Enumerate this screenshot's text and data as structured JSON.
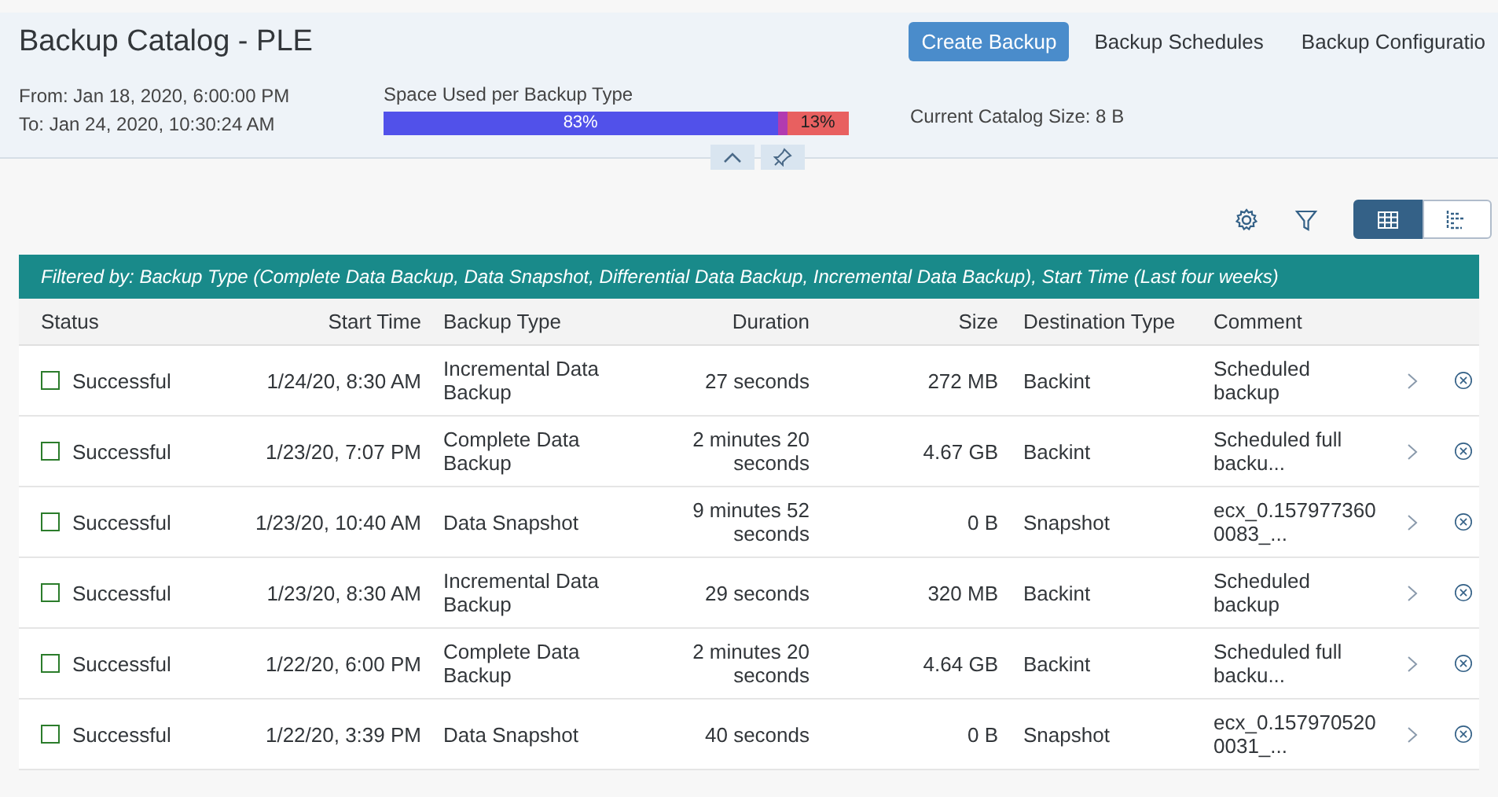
{
  "header": {
    "title": "Backup Catalog - PLE",
    "actions": [
      {
        "label": "Create Backup",
        "emphasized": true
      },
      {
        "label": "Backup Schedules",
        "emphasized": false
      },
      {
        "label": "Backup Configuratio",
        "emphasized": false
      }
    ],
    "from": "From: Jan 18, 2020, 6:00:00 PM",
    "to": "To: Jan 24, 2020, 10:30:24 AM",
    "space_label": "Space Used per Backup Type",
    "segments": [
      {
        "color": "#5151ea",
        "label": "83%"
      },
      {
        "color": "#b23bb0"
      },
      {
        "color": "#e86060",
        "label": "13%"
      }
    ],
    "catalog_size": "Current Catalog Size: 8 B"
  },
  "view_toggle": [
    {
      "kind": "table",
      "selected": true
    },
    {
      "kind": "chart",
      "selected": false
    }
  ],
  "filter_text": "Filtered by: Backup Type (Complete Data Backup, Data Snapshot, Differential Data Backup, Incremental Data Backup), Start Time (Last four weeks)",
  "table": {
    "columns": [
      "Status",
      "Start Time",
      "Backup Type",
      "Duration",
      "Size",
      "Destination Type",
      "Comment"
    ],
    "rows": [
      {
        "status": "Successful",
        "start": "1/24/20, 8:30 AM",
        "type": "Incremental Data Backup",
        "duration": "27 seconds",
        "size": "272 MB",
        "destination": "Backint",
        "comment": "Scheduled backup"
      },
      {
        "status": "Successful",
        "start": "1/23/20, 7:07 PM",
        "type": "Complete Data Backup",
        "duration": "2 minutes 20 seconds",
        "size": "4.67 GB",
        "destination": "Backint",
        "comment": "Scheduled full backu..."
      },
      {
        "status": "Successful",
        "start": "1/23/20, 10:40 AM",
        "type": "Data Snapshot",
        "duration": "9 minutes 52 seconds",
        "size": "0 B",
        "destination": "Snapshot",
        "comment": "ecx_0.1579773600083_..."
      },
      {
        "status": "Successful",
        "start": "1/23/20, 8:30 AM",
        "type": "Incremental Data Backup",
        "duration": "29 seconds",
        "size": "320 MB",
        "destination": "Backint",
        "comment": "Scheduled backup"
      },
      {
        "status": "Successful",
        "start": "1/22/20, 6:00 PM",
        "type": "Complete Data Backup",
        "duration": "2 minutes 20 seconds",
        "size": "4.64 GB",
        "destination": "Backint",
        "comment": "Scheduled full backu..."
      },
      {
        "status": "Successful",
        "start": "1/22/20, 3:39 PM",
        "type": "Data Snapshot",
        "duration": "40 seconds",
        "size": "0 B",
        "destination": "Snapshot",
        "comment": "ecx_0.1579705200031_..."
      }
    ]
  }
}
